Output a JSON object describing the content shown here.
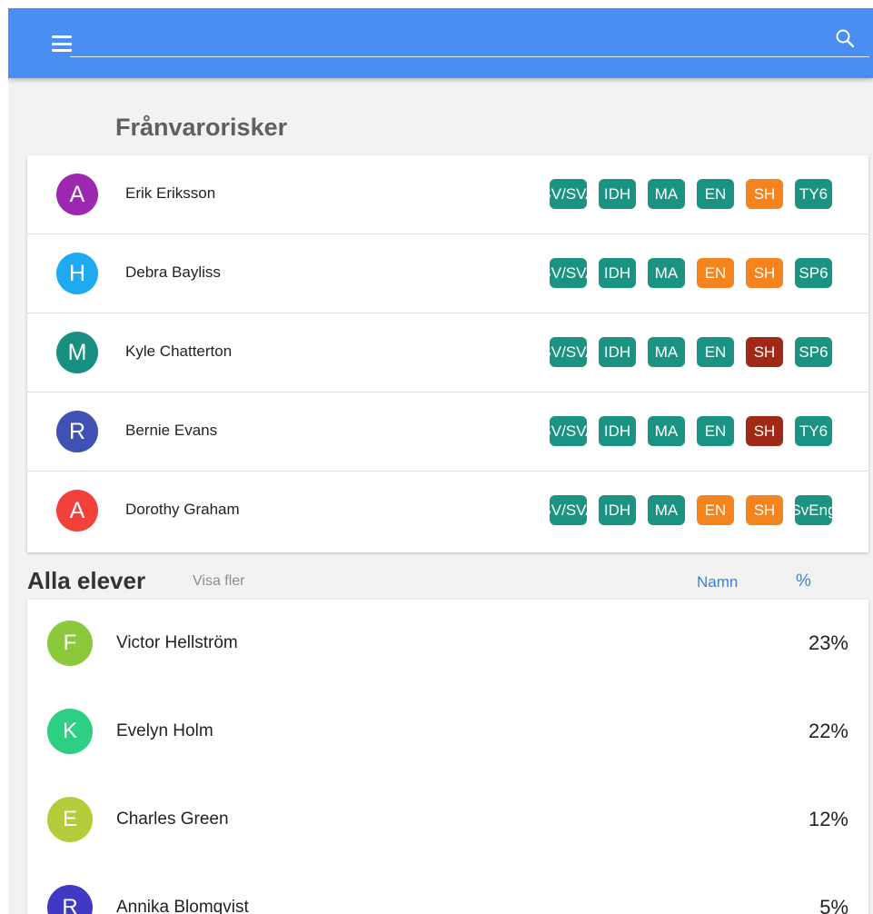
{
  "appbar": {
    "menu_icon": "hamburger-menu-icon",
    "search_icon": "search-icon",
    "background": "#4a8ef3"
  },
  "risk_section": {
    "title": "Frånvarorisker",
    "students": [
      {
        "initial": "A",
        "name": "Erik Eriksson",
        "avatar_color": "#9c27b0",
        "courses": [
          {
            "code": "SV/SVA",
            "color": "#1a9382"
          },
          {
            "code": "IDH",
            "color": "#1a9382"
          },
          {
            "code": "MA",
            "color": "#1a9382"
          },
          {
            "code": "EN",
            "color": "#1a9382"
          },
          {
            "code": "SH",
            "color": "#f5841f"
          },
          {
            "code": "TY6",
            "color": "#1a9382"
          }
        ]
      },
      {
        "initial": "H",
        "name": "Debra Bayliss",
        "avatar_color": "#1eaaf1",
        "courses": [
          {
            "code": "SV/SVA",
            "color": "#1a9382"
          },
          {
            "code": "IDH",
            "color": "#1a9382"
          },
          {
            "code": "MA",
            "color": "#1a9382"
          },
          {
            "code": "EN",
            "color": "#f5841f"
          },
          {
            "code": "SH",
            "color": "#f5841f"
          },
          {
            "code": "SP6",
            "color": "#1a9382"
          }
        ]
      },
      {
        "initial": "M",
        "name": "Kyle Chatterton",
        "avatar_color": "#168f80",
        "courses": [
          {
            "code": "SV/SVA",
            "color": "#1a9382"
          },
          {
            "code": "IDH",
            "color": "#1a9382"
          },
          {
            "code": "MA",
            "color": "#1a9382"
          },
          {
            "code": "EN",
            "color": "#1a9382"
          },
          {
            "code": "SH",
            "color": "#a02a17"
          },
          {
            "code": "SP6",
            "color": "#1a9382"
          }
        ]
      },
      {
        "initial": "R",
        "name": "Bernie Evans",
        "avatar_color": "#3f51b5",
        "courses": [
          {
            "code": "SV/SVA",
            "color": "#1a9382"
          },
          {
            "code": "IDH",
            "color": "#1a9382"
          },
          {
            "code": "MA",
            "color": "#1a9382"
          },
          {
            "code": "EN",
            "color": "#1a9382"
          },
          {
            "code": "SH",
            "color": "#a02a17"
          },
          {
            "code": "TY6",
            "color": "#1a9382"
          }
        ]
      },
      {
        "initial": "A",
        "name": "Dorothy Graham",
        "avatar_color": "#f2413a",
        "courses": [
          {
            "code": "SV/SVA",
            "color": "#1a9382"
          },
          {
            "code": "IDH",
            "color": "#1a9382"
          },
          {
            "code": "MA",
            "color": "#1a9382"
          },
          {
            "code": "EN",
            "color": "#f5841f"
          },
          {
            "code": "SH",
            "color": "#f5841f"
          },
          {
            "code": "SvEng",
            "color": "#1a9382"
          }
        ]
      }
    ]
  },
  "all_section": {
    "title": "Alla elever",
    "show_more": "Visa fler",
    "sort_name": "Namn",
    "sort_percent": "%",
    "students": [
      {
        "initial": "F",
        "name": "Victor Hellström",
        "percent": "23%",
        "avatar_color": "#8bc83c"
      },
      {
        "initial": "K",
        "name": "Evelyn Holm",
        "percent": "22%",
        "avatar_color": "#2ecf82"
      },
      {
        "initial": "E",
        "name": "Charles Green",
        "percent": "12%",
        "avatar_color": "#b5cc3a"
      },
      {
        "initial": "R",
        "name": "Annika Blomqvist",
        "percent": "5%",
        "avatar_color": "#3f39c4"
      }
    ]
  }
}
